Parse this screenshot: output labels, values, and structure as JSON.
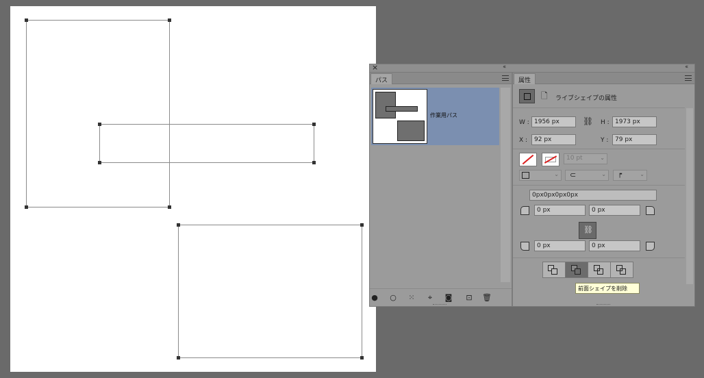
{
  "paths_panel": {
    "tab_label": "パス",
    "path_item": "作業用パス"
  },
  "properties_panel": {
    "tab_label": "属性",
    "section_title": "ライブシェイプの属性",
    "w_label": "W :",
    "w_value": "1956 px",
    "h_label": "H :",
    "h_value": "1973 px",
    "x_label": "X :",
    "x_value": "92 px",
    "y_label": "Y :",
    "y_value": "79 px",
    "stroke_width": "10 pt",
    "corner_radius_summary": "0px0px0px0px",
    "corner_tl": "0 px",
    "corner_tr": "0 px",
    "corner_bl": "0 px",
    "corner_br": "0 px"
  },
  "tooltip": "前面シェイプを削除"
}
